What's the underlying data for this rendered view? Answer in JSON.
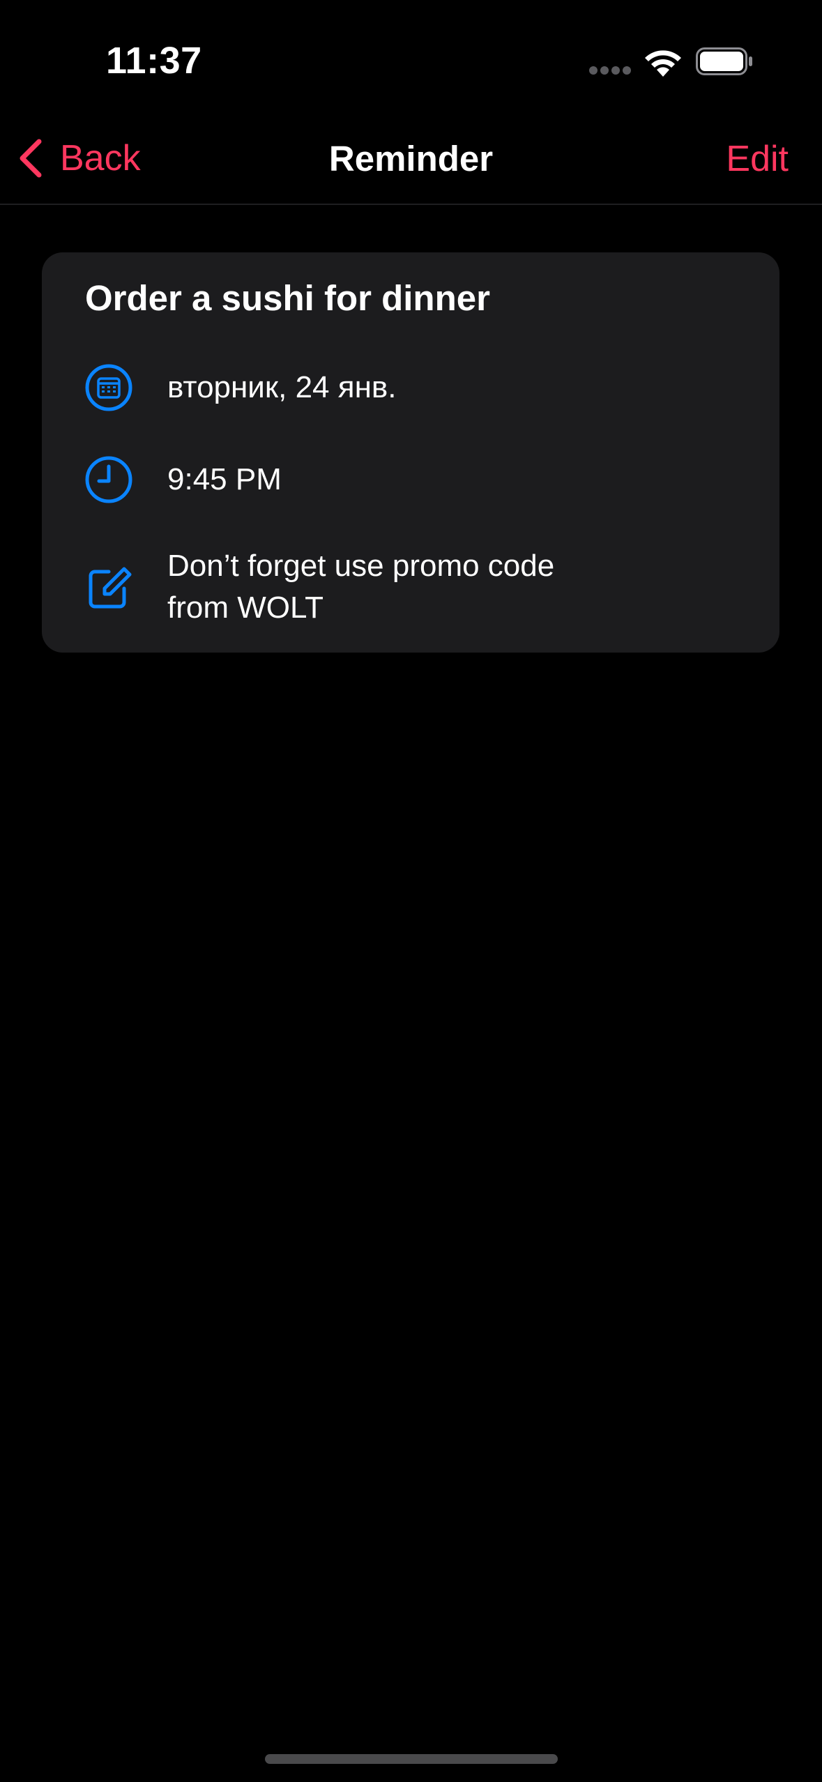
{
  "status_bar": {
    "time": "11:37"
  },
  "nav": {
    "back_label": "Back",
    "title": "Reminder",
    "edit_label": "Edit"
  },
  "reminder": {
    "title": "Order a sushi for dinner",
    "date": "вторник, 24 янв.",
    "time": "9:45 PM",
    "note": "Don’t forget use promo code from WOLT"
  },
  "icons": {
    "date": "calendar-icon",
    "time": "clock-icon",
    "note": "edit-note-icon"
  },
  "colors": {
    "accent": "#ff375f",
    "icon_blue": "#0a84ff",
    "card_bg": "#1c1c1e",
    "background": "#000000"
  }
}
